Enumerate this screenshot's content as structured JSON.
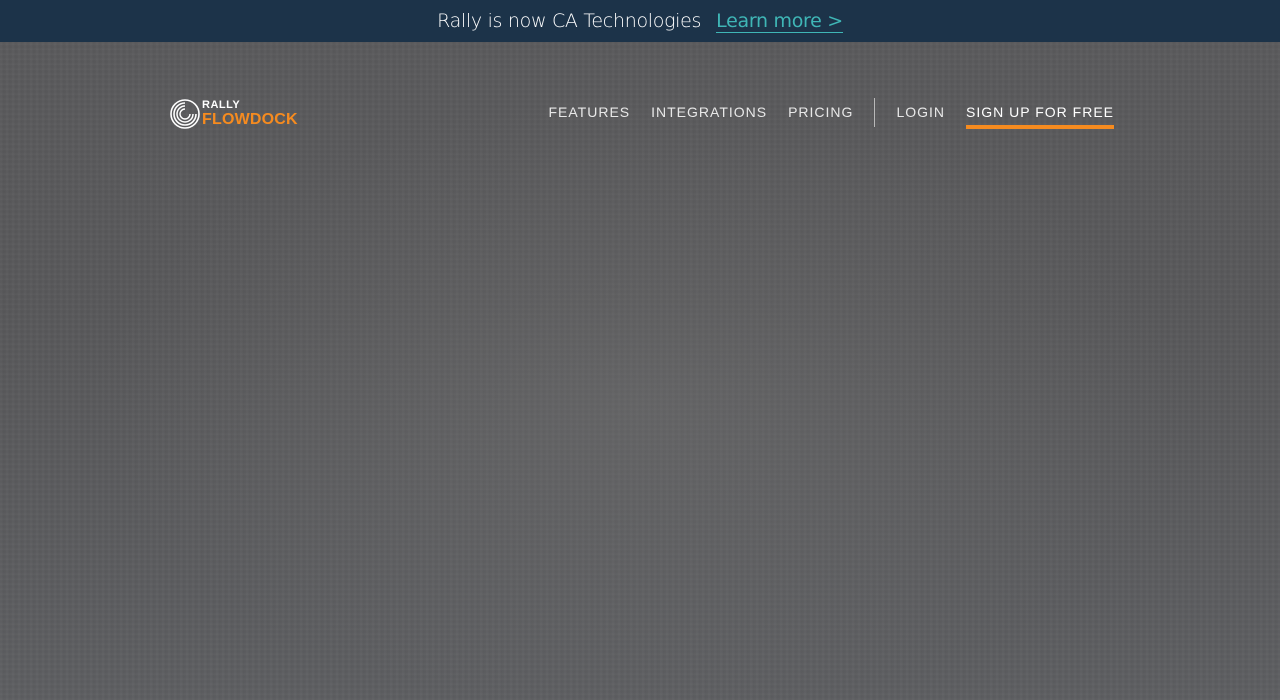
{
  "banner": {
    "text": "Rally is now CA Technologies",
    "link_label": "Learn more >"
  },
  "logo": {
    "top_word": "RALLY",
    "bottom_word": "FLOWDOCK",
    "icon": "concentric-circles-icon"
  },
  "nav": {
    "features": "FEATURES",
    "integrations": "INTEGRATIONS",
    "pricing": "PRICING",
    "login": "LOGIN",
    "signup": "SIGN UP FOR FREE"
  },
  "colors": {
    "banner_bg": "#1c3349",
    "link": "#3fb6b6",
    "accent": "#f68b1f",
    "hero_bg": "#5a5a5c"
  }
}
